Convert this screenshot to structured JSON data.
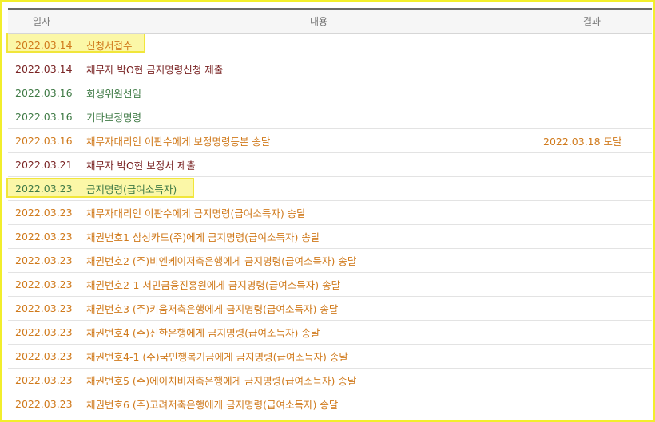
{
  "table": {
    "headers": {
      "date": "일자",
      "content": "내용",
      "result": "결과"
    },
    "rows": [
      {
        "date": "2022.03.14",
        "content": "신청서접수",
        "result": "",
        "color": "#d07a1c",
        "highlighted": true
      },
      {
        "date": "2022.03.14",
        "content": "채무자 박O현 금지명령신청 제출",
        "result": "",
        "color": "#7a2424",
        "highlighted": false
      },
      {
        "date": "2022.03.16",
        "content": "회생위원선임",
        "result": "",
        "color": "#3f7a45",
        "highlighted": false
      },
      {
        "date": "2022.03.16",
        "content": "기타보정명령",
        "result": "",
        "color": "#3f7a45",
        "highlighted": false
      },
      {
        "date": "2022.03.16",
        "content": "채무자대리인 이판수에게 보정명령등본 송달",
        "result": "2022.03.18 도달",
        "color": "#d07a1c",
        "highlighted": false
      },
      {
        "date": "2022.03.21",
        "content": "채무자 박O현 보정서 제출",
        "result": "",
        "color": "#7a2424",
        "highlighted": false
      },
      {
        "date": "2022.03.23",
        "content": "금지명령(급여소득자)",
        "result": "",
        "color": "#3f7a45",
        "highlighted": true
      },
      {
        "date": "2022.03.23",
        "content": "채무자대리인 이판수에게 금지명령(급여소득자) 송달",
        "result": "",
        "color": "#d07a1c",
        "highlighted": false
      },
      {
        "date": "2022.03.23",
        "content": "채권번호1 삼성카드(주)에게 금지명령(급여소득자) 송달",
        "result": "",
        "color": "#d07a1c",
        "highlighted": false
      },
      {
        "date": "2022.03.23",
        "content": "채권번호2 (주)비엔케이저축은행에게 금지명령(급여소득자) 송달",
        "result": "",
        "color": "#d07a1c",
        "highlighted": false
      },
      {
        "date": "2022.03.23",
        "content": "채권번호2-1 서민금융진흥원에게 금지명령(급여소득자) 송달",
        "result": "",
        "color": "#d07a1c",
        "highlighted": false
      },
      {
        "date": "2022.03.23",
        "content": "채권번호3 (주)키움저축은행에게 금지명령(급여소득자) 송달",
        "result": "",
        "color": "#d07a1c",
        "highlighted": false
      },
      {
        "date": "2022.03.23",
        "content": "채권번호4 (주)신한은행에게 금지명령(급여소득자) 송달",
        "result": "",
        "color": "#d07a1c",
        "highlighted": false
      },
      {
        "date": "2022.03.23",
        "content": "채권번호4-1 (주)국민행복기금에게 금지명령(급여소득자) 송달",
        "result": "",
        "color": "#d07a1c",
        "highlighted": false
      },
      {
        "date": "2022.03.23",
        "content": "채권번호5 (주)에이치비저축은행에게 금지명령(급여소득자) 송달",
        "result": "",
        "color": "#d07a1c",
        "highlighted": false
      },
      {
        "date": "2022.03.23",
        "content": "채권번호6 (주)고려저축은행에게 금지명령(급여소득자) 송달",
        "result": "",
        "color": "#d07a1c",
        "highlighted": false
      }
    ]
  },
  "colors": {
    "frame_border": "#f2ee2c",
    "highlight_fill": "#fbf7a7",
    "header_rule": "#6b6b6b"
  }
}
